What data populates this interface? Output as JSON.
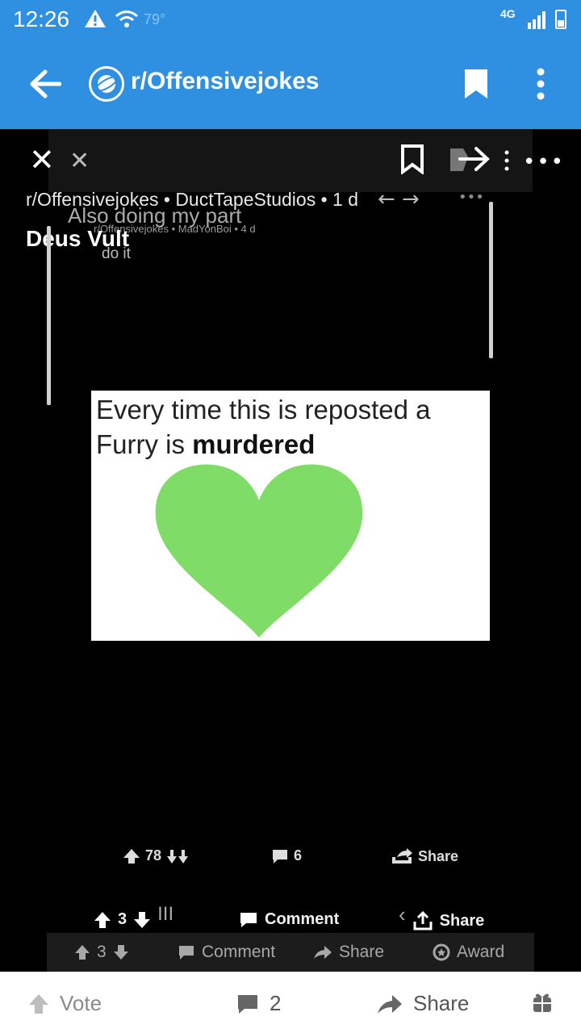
{
  "status_bar": {
    "time": "12:26",
    "temperature": "79°",
    "network": "4G"
  },
  "app_bar": {
    "subreddit": "r/Offensivejokes"
  },
  "post": {
    "meta": "r/Offensivejokes • DuctTapeStudios • 1 d",
    "title": "Deus Vult",
    "ghost_title": "Also doing my part",
    "ghost_meta": "r/Offensivejokes • MadYonBoi • 4 d",
    "ghost_body": "do it",
    "meme_text_plain": "Every time this is reposted a Furry is",
    "meme_text_bold": "murdered",
    "heart_color": "#7fdc66"
  },
  "actions_inner": {
    "upvotes": "78",
    "comments": "6",
    "share": "Share"
  },
  "actions_middle": {
    "votes": "3",
    "comment": "Comment",
    "share": "Share"
  },
  "actions_ghost": {
    "votes": "3",
    "comment": "Comment",
    "share": "Share",
    "award": "Award"
  },
  "bottom_bar": {
    "vote": "Vote",
    "comments": "2",
    "share": "Share"
  },
  "colors": {
    "app_bar": "#2f8fe0",
    "background": "#000000"
  }
}
